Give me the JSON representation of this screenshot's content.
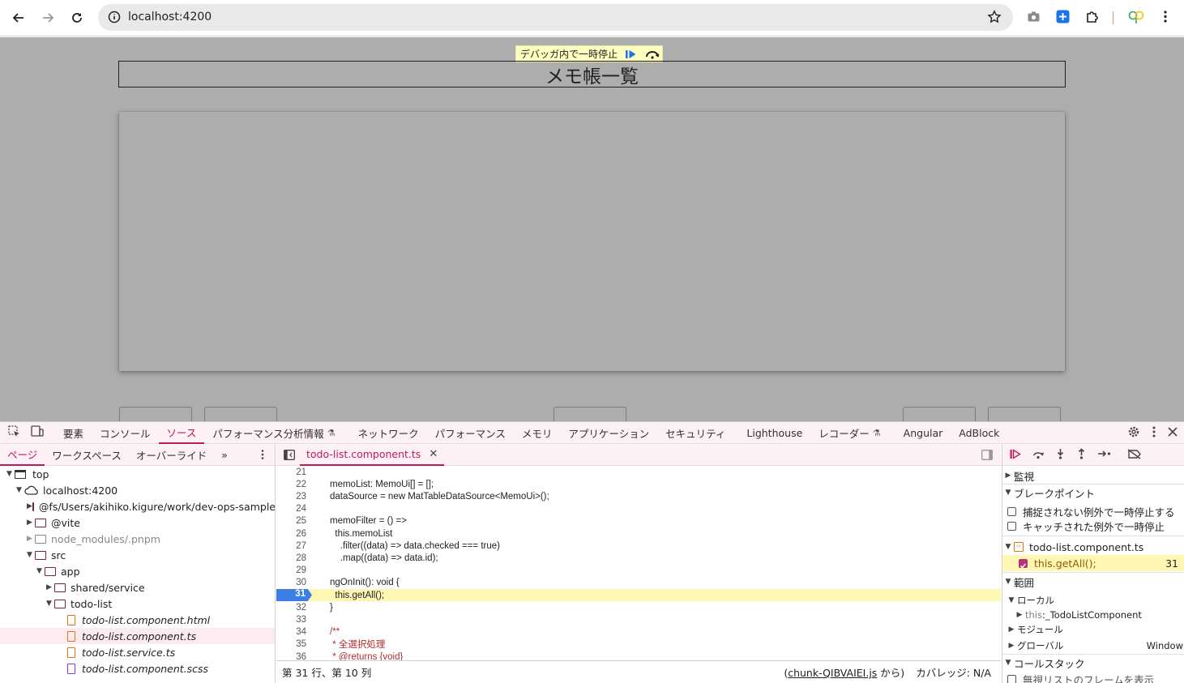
{
  "browser": {
    "url": "localhost:4200"
  },
  "page": {
    "paused_label": "デバッガ内で一時停止",
    "heading": "メモ帳一覧"
  },
  "devtools": {
    "tabs": [
      "要素",
      "コンソール",
      "ソース",
      "パフォーマンス分析情報",
      "ネットワーク",
      "パフォーマンス",
      "メモリ",
      "アプリケーション",
      "セキュリティ",
      "Lighthouse",
      "レコーダー",
      "Angular",
      "AdBlock"
    ],
    "active_tab": "ソース",
    "navigator_tabs": [
      "ページ",
      "ワークスペース",
      "オーバーライド"
    ],
    "tree": [
      {
        "label": "top"
      },
      {
        "label": "localhost:4200"
      },
      {
        "label": "@fs/Users/akihiko.kigure/work/dev-ops-sample/f"
      },
      {
        "label": "@vite"
      },
      {
        "label": "node_modules/.pnpm"
      },
      {
        "label": "src"
      },
      {
        "label": "app"
      },
      {
        "label": "shared/service"
      },
      {
        "label": "todo-list"
      },
      {
        "label": "todo-list.component.html"
      },
      {
        "label": "todo-list.component.ts"
      },
      {
        "label": "todo-list.service.ts"
      },
      {
        "label": "todo-list.component.scss"
      }
    ],
    "editor": {
      "file_tab": "todo-list.component.ts",
      "lines": [
        {
          "n": "21",
          "t": ""
        },
        {
          "n": "22",
          "t": "memoList: MemoUi[] = [];"
        },
        {
          "n": "23",
          "t": "dataSource = new MatTableDataSource<MemoUi>();"
        },
        {
          "n": "24",
          "t": ""
        },
        {
          "n": "25",
          "t": "memoFilter = () =>"
        },
        {
          "n": "26",
          "t": "  this.memoList"
        },
        {
          "n": "27",
          "t": "    .filter((data) => data.checked === true)"
        },
        {
          "n": "28",
          "t": "    .map((data) => data.id);"
        },
        {
          "n": "29",
          "t": ""
        },
        {
          "n": "30",
          "t": "ngOnInit(): void {"
        },
        {
          "n": "31",
          "t": "  this.getAll();"
        },
        {
          "n": "32",
          "t": "}"
        },
        {
          "n": "33",
          "t": ""
        },
        {
          "n": "34",
          "t": "/**"
        },
        {
          "n": "35",
          "t": " * 全選択処理"
        },
        {
          "n": "36",
          "t": " * @returns {void}"
        }
      ],
      "status_position": "第 31 行、第 10 列",
      "status_source_prefix": "(",
      "status_source_link": "chunk-QIBVAIEI.js",
      "status_source_suffix": " から)",
      "status_coverage": "カバレッジ: N/A"
    },
    "sidebar": {
      "watch": "監視",
      "breakpoints": "ブレークポイント",
      "pause_uncaught": "捕捉されない例外で一時停止する",
      "pause_caught": "キャッチされた例外で一時停止",
      "bp_file": "todo-list.component.ts",
      "bp_code": "this.getAll();",
      "bp_line": "31",
      "scope": "範囲",
      "local": "ローカル",
      "this_key": "this",
      "this_value": "_TodoListComponent",
      "module": "モジュール",
      "global": "グローバル",
      "global_value": "Window",
      "call_stack": "コールスタック",
      "ignore_list": "無視リストのフレームを表示"
    }
  }
}
